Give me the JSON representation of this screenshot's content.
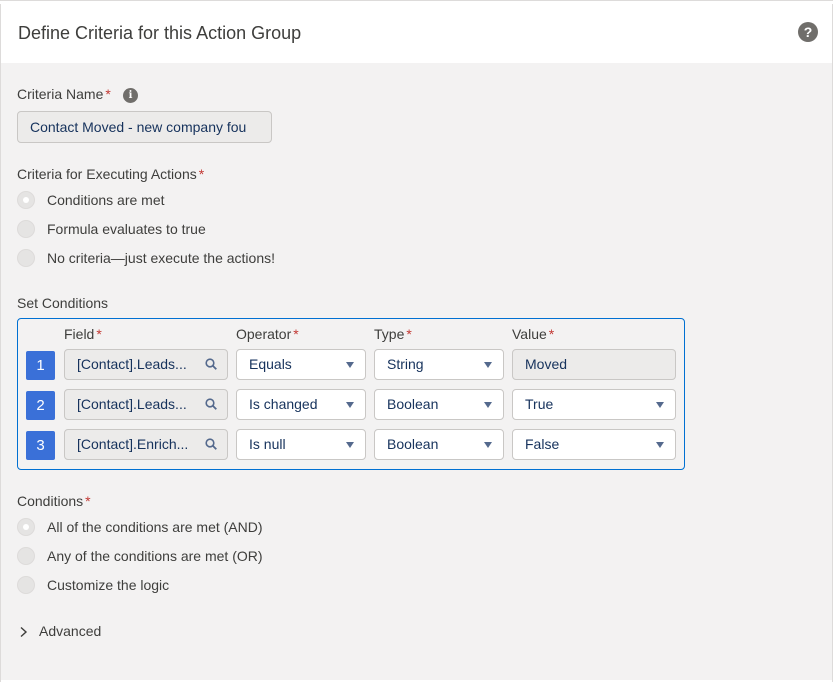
{
  "header": {
    "title": "Define Criteria for this Action Group",
    "help_icon": "question-icon"
  },
  "criteria_name": {
    "label": "Criteria Name",
    "value": "Contact Moved - new company fou"
  },
  "executing": {
    "label": "Criteria for Executing Actions",
    "options": [
      "Conditions are met",
      "Formula evaluates to true",
      "No criteria—just execute the actions!"
    ],
    "selected": 0
  },
  "set_conditions": {
    "label": "Set Conditions",
    "columns": {
      "field": "Field",
      "operator": "Operator",
      "type": "Type",
      "value": "Value"
    },
    "rows": [
      {
        "num": "1",
        "field": "[Contact].Leads...",
        "operator": "Equals",
        "type": "String",
        "value": "Moved"
      },
      {
        "num": "2",
        "field": "[Contact].Leads...",
        "operator": "Is changed",
        "type": "Boolean",
        "value": "True"
      },
      {
        "num": "3",
        "field": "[Contact].Enrich...",
        "operator": "Is null",
        "type": "Boolean",
        "value": "False"
      }
    ]
  },
  "conditions": {
    "label": "Conditions",
    "options": [
      "All of the conditions are met (AND)",
      "Any of the conditions are met (OR)",
      "Customize the logic"
    ],
    "selected": 0
  },
  "advanced": {
    "label": "Advanced"
  },
  "colors": {
    "accent": "#0070d2",
    "row_number": "#3a70d8",
    "required": "#c23934"
  }
}
